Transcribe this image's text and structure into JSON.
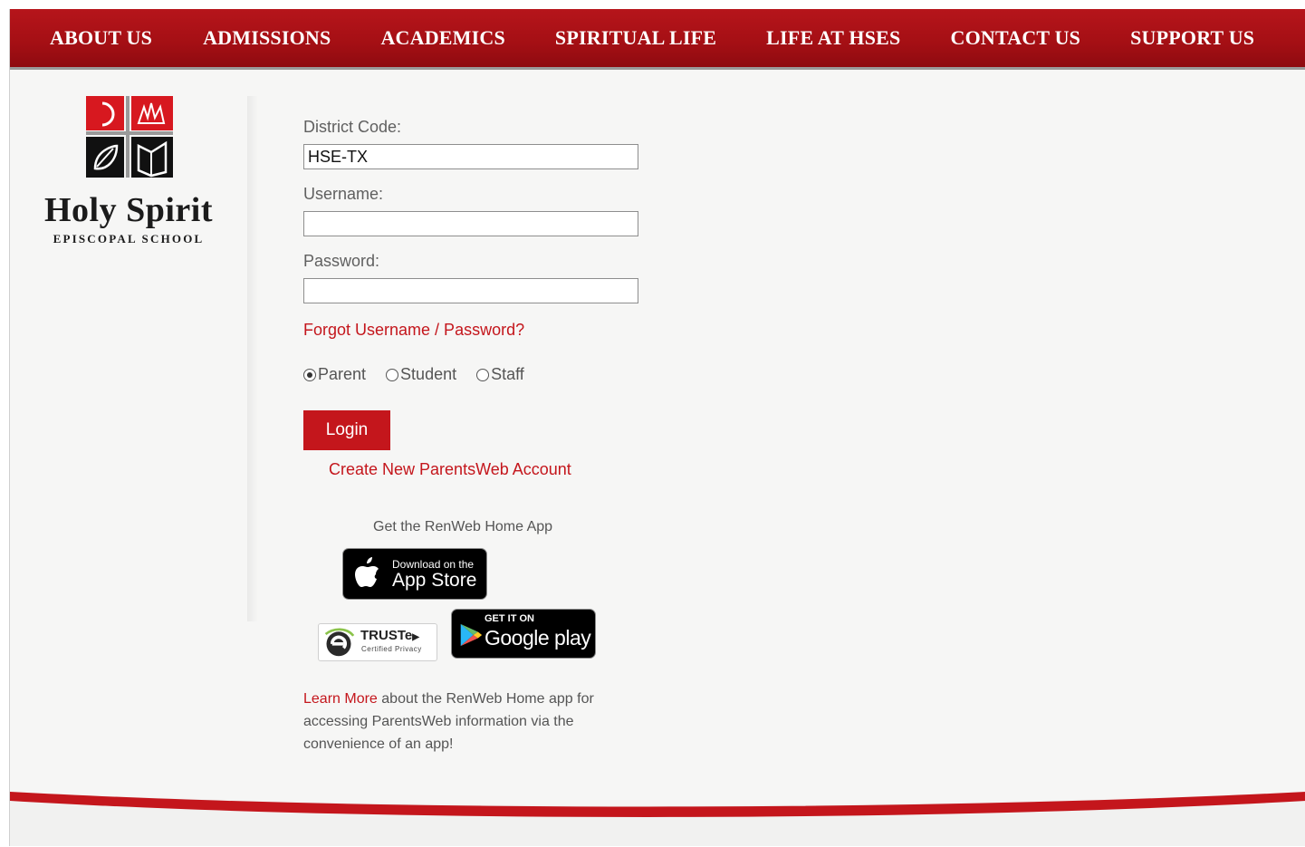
{
  "nav": {
    "items": [
      "About Us",
      "Admissions",
      "Academics",
      "Spiritual Life",
      "Life at HSES",
      "Contact Us",
      "Support Us"
    ]
  },
  "logo": {
    "name": "Holy Spirit",
    "subtitle": "EPISCOPAL SCHOOL"
  },
  "form": {
    "district_label": "District Code:",
    "district_value": "HSE-TX",
    "username_label": "Username:",
    "username_value": "",
    "password_label": "Password:",
    "password_value": "",
    "forgot_link": "Forgot Username / Password?",
    "roles": [
      {
        "label": "Parent",
        "selected": true
      },
      {
        "label": "Student",
        "selected": false
      },
      {
        "label": "Staff",
        "selected": false
      }
    ],
    "login_button": "Login",
    "create_account_link": "Create New ParentsWeb Account"
  },
  "app": {
    "heading": "Get the RenWeb Home App",
    "appstore_small": "Download on the",
    "appstore_big": "App Store",
    "googleplay_small": "GET IT ON",
    "googleplay_big": "Google play",
    "truste_big": "TRUSTe",
    "truste_small": "Certified Privacy",
    "learn_more_link": "Learn More",
    "learn_more_text": " about the RenWeb Home app for accessing ParentsWeb information via the convenience of an app!"
  },
  "colors": {
    "brand_red": "#c4161c",
    "nav_red": "#a40f14",
    "background": "#f6f6f5"
  }
}
